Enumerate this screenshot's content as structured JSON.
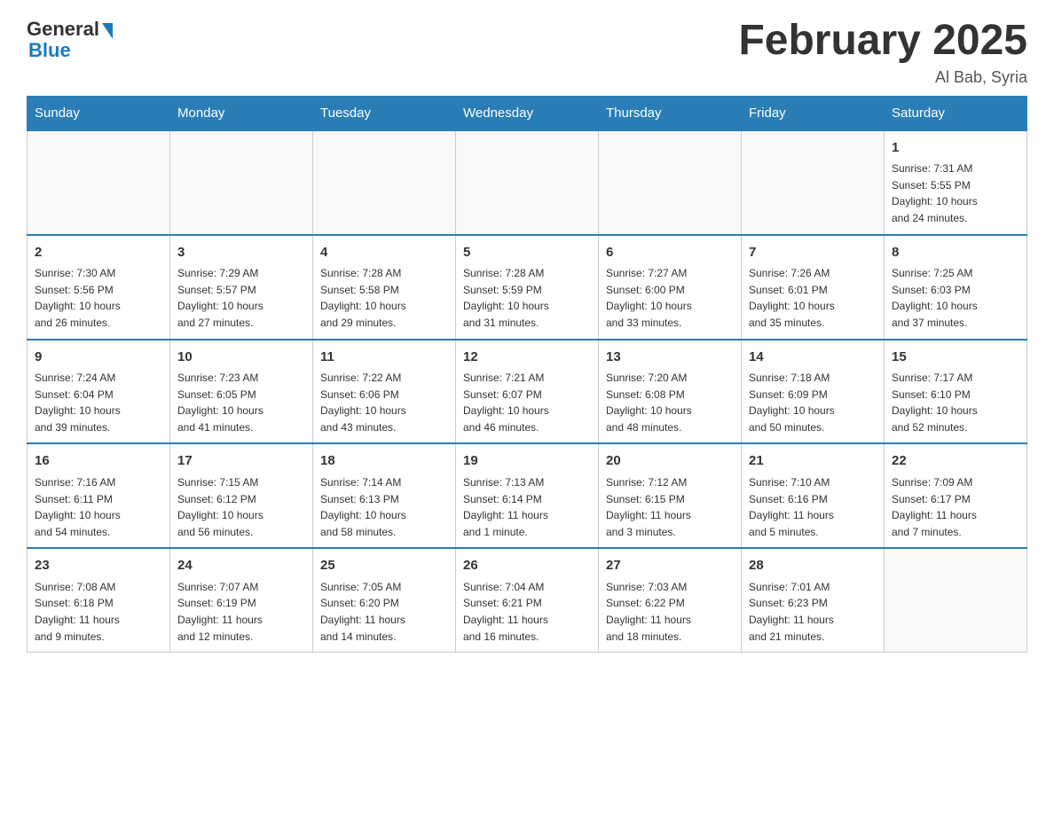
{
  "header": {
    "logo_general": "General",
    "logo_blue": "Blue",
    "month_title": "February 2025",
    "location": "Al Bab, Syria"
  },
  "weekdays": [
    "Sunday",
    "Monday",
    "Tuesday",
    "Wednesday",
    "Thursday",
    "Friday",
    "Saturday"
  ],
  "weeks": [
    [
      {
        "day": "",
        "info": ""
      },
      {
        "day": "",
        "info": ""
      },
      {
        "day": "",
        "info": ""
      },
      {
        "day": "",
        "info": ""
      },
      {
        "day": "",
        "info": ""
      },
      {
        "day": "",
        "info": ""
      },
      {
        "day": "1",
        "info": "Sunrise: 7:31 AM\nSunset: 5:55 PM\nDaylight: 10 hours\nand 24 minutes."
      }
    ],
    [
      {
        "day": "2",
        "info": "Sunrise: 7:30 AM\nSunset: 5:56 PM\nDaylight: 10 hours\nand 26 minutes."
      },
      {
        "day": "3",
        "info": "Sunrise: 7:29 AM\nSunset: 5:57 PM\nDaylight: 10 hours\nand 27 minutes."
      },
      {
        "day": "4",
        "info": "Sunrise: 7:28 AM\nSunset: 5:58 PM\nDaylight: 10 hours\nand 29 minutes."
      },
      {
        "day": "5",
        "info": "Sunrise: 7:28 AM\nSunset: 5:59 PM\nDaylight: 10 hours\nand 31 minutes."
      },
      {
        "day": "6",
        "info": "Sunrise: 7:27 AM\nSunset: 6:00 PM\nDaylight: 10 hours\nand 33 minutes."
      },
      {
        "day": "7",
        "info": "Sunrise: 7:26 AM\nSunset: 6:01 PM\nDaylight: 10 hours\nand 35 minutes."
      },
      {
        "day": "8",
        "info": "Sunrise: 7:25 AM\nSunset: 6:03 PM\nDaylight: 10 hours\nand 37 minutes."
      }
    ],
    [
      {
        "day": "9",
        "info": "Sunrise: 7:24 AM\nSunset: 6:04 PM\nDaylight: 10 hours\nand 39 minutes."
      },
      {
        "day": "10",
        "info": "Sunrise: 7:23 AM\nSunset: 6:05 PM\nDaylight: 10 hours\nand 41 minutes."
      },
      {
        "day": "11",
        "info": "Sunrise: 7:22 AM\nSunset: 6:06 PM\nDaylight: 10 hours\nand 43 minutes."
      },
      {
        "day": "12",
        "info": "Sunrise: 7:21 AM\nSunset: 6:07 PM\nDaylight: 10 hours\nand 46 minutes."
      },
      {
        "day": "13",
        "info": "Sunrise: 7:20 AM\nSunset: 6:08 PM\nDaylight: 10 hours\nand 48 minutes."
      },
      {
        "day": "14",
        "info": "Sunrise: 7:18 AM\nSunset: 6:09 PM\nDaylight: 10 hours\nand 50 minutes."
      },
      {
        "day": "15",
        "info": "Sunrise: 7:17 AM\nSunset: 6:10 PM\nDaylight: 10 hours\nand 52 minutes."
      }
    ],
    [
      {
        "day": "16",
        "info": "Sunrise: 7:16 AM\nSunset: 6:11 PM\nDaylight: 10 hours\nand 54 minutes."
      },
      {
        "day": "17",
        "info": "Sunrise: 7:15 AM\nSunset: 6:12 PM\nDaylight: 10 hours\nand 56 minutes."
      },
      {
        "day": "18",
        "info": "Sunrise: 7:14 AM\nSunset: 6:13 PM\nDaylight: 10 hours\nand 58 minutes."
      },
      {
        "day": "19",
        "info": "Sunrise: 7:13 AM\nSunset: 6:14 PM\nDaylight: 11 hours\nand 1 minute."
      },
      {
        "day": "20",
        "info": "Sunrise: 7:12 AM\nSunset: 6:15 PM\nDaylight: 11 hours\nand 3 minutes."
      },
      {
        "day": "21",
        "info": "Sunrise: 7:10 AM\nSunset: 6:16 PM\nDaylight: 11 hours\nand 5 minutes."
      },
      {
        "day": "22",
        "info": "Sunrise: 7:09 AM\nSunset: 6:17 PM\nDaylight: 11 hours\nand 7 minutes."
      }
    ],
    [
      {
        "day": "23",
        "info": "Sunrise: 7:08 AM\nSunset: 6:18 PM\nDaylight: 11 hours\nand 9 minutes."
      },
      {
        "day": "24",
        "info": "Sunrise: 7:07 AM\nSunset: 6:19 PM\nDaylight: 11 hours\nand 12 minutes."
      },
      {
        "day": "25",
        "info": "Sunrise: 7:05 AM\nSunset: 6:20 PM\nDaylight: 11 hours\nand 14 minutes."
      },
      {
        "day": "26",
        "info": "Sunrise: 7:04 AM\nSunset: 6:21 PM\nDaylight: 11 hours\nand 16 minutes."
      },
      {
        "day": "27",
        "info": "Sunrise: 7:03 AM\nSunset: 6:22 PM\nDaylight: 11 hours\nand 18 minutes."
      },
      {
        "day": "28",
        "info": "Sunrise: 7:01 AM\nSunset: 6:23 PM\nDaylight: 11 hours\nand 21 minutes."
      },
      {
        "day": "",
        "info": ""
      }
    ]
  ]
}
